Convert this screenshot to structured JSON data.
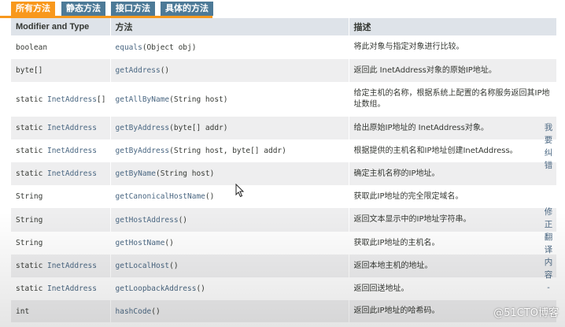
{
  "tabs": [
    {
      "label": "所有方法"
    },
    {
      "label": "静态方法"
    },
    {
      "label": "接口方法"
    },
    {
      "label": "具体的方法"
    }
  ],
  "table": {
    "headers": [
      "Modifier and Type",
      "方法",
      "描述"
    ],
    "rows": [
      {
        "modifier_pre": "boolean",
        "modifier_link": "",
        "modifier_post": "",
        "method_name": "equals",
        "method_params": "(Object obj)",
        "description": "将此对象与指定对象进行比较。"
      },
      {
        "modifier_pre": "byte[]",
        "modifier_link": "",
        "modifier_post": "",
        "method_name": "getAddress",
        "method_params": "()",
        "description": "返回此 InetAddress对象的原始IP地址。"
      },
      {
        "modifier_pre": "static ",
        "modifier_link": "InetAddress",
        "modifier_post": "[]",
        "method_name": "getAllByName",
        "method_params": "(String host)",
        "description": "给定主机的名称，根据系统上配置的名称服务返回其IP地址数组。"
      },
      {
        "modifier_pre": "static ",
        "modifier_link": "InetAddress",
        "modifier_post": "",
        "method_name": "getByAddress",
        "method_params": "(byte[] addr)",
        "description": "给出原始IP地址的 InetAddress对象。"
      },
      {
        "modifier_pre": "static ",
        "modifier_link": "InetAddress",
        "modifier_post": "",
        "method_name": "getByAddress",
        "method_params": "(String host, byte[] addr)",
        "description": "根据提供的主机名和IP地址创建InetAddress。"
      },
      {
        "modifier_pre": "static ",
        "modifier_link": "InetAddress",
        "modifier_post": "",
        "method_name": "getByName",
        "method_params": "(String host)",
        "description": "确定主机名称的IP地址。"
      },
      {
        "modifier_pre": "String",
        "modifier_link": "",
        "modifier_post": "",
        "method_name": "getCanonicalHostName",
        "method_params": "()",
        "description": "获取此IP地址的完全限定域名。"
      },
      {
        "modifier_pre": "String",
        "modifier_link": "",
        "modifier_post": "",
        "method_name": "getHostAddress",
        "method_params": "()",
        "description": "返回文本显示中的IP地址字符串。"
      },
      {
        "modifier_pre": "String",
        "modifier_link": "",
        "modifier_post": "",
        "method_name": "getHostName",
        "method_params": "()",
        "description": "获取此IP地址的主机名。"
      },
      {
        "modifier_pre": "static ",
        "modifier_link": "InetAddress",
        "modifier_post": "",
        "method_name": "getLocalHost",
        "method_params": "()",
        "description": "返回本地主机的地址。"
      },
      {
        "modifier_pre": "static ",
        "modifier_link": "InetAddress",
        "modifier_post": "",
        "method_name": "getLoopbackAddress",
        "method_params": "()",
        "description": "返回回送地址。"
      },
      {
        "modifier_pre": "int",
        "modifier_link": "",
        "modifier_post": "",
        "method_name": "hashCode",
        "method_params": "()",
        "description": "返回此IP地址的哈希码。"
      }
    ]
  },
  "side": {
    "report_error": [
      "我",
      "要",
      "纠",
      "错"
    ],
    "edit_content": [
      "修",
      "正",
      "翻",
      "译",
      "内",
      "容",
      "-"
    ]
  },
  "watermark": "@51CTO博客",
  "colors": {
    "tab_active": "#f8981d",
    "tab_inactive": "#4d7a97",
    "header_bg": "#dee3e9",
    "row_alt": "#eeeeef",
    "link": "#4a6782"
  }
}
